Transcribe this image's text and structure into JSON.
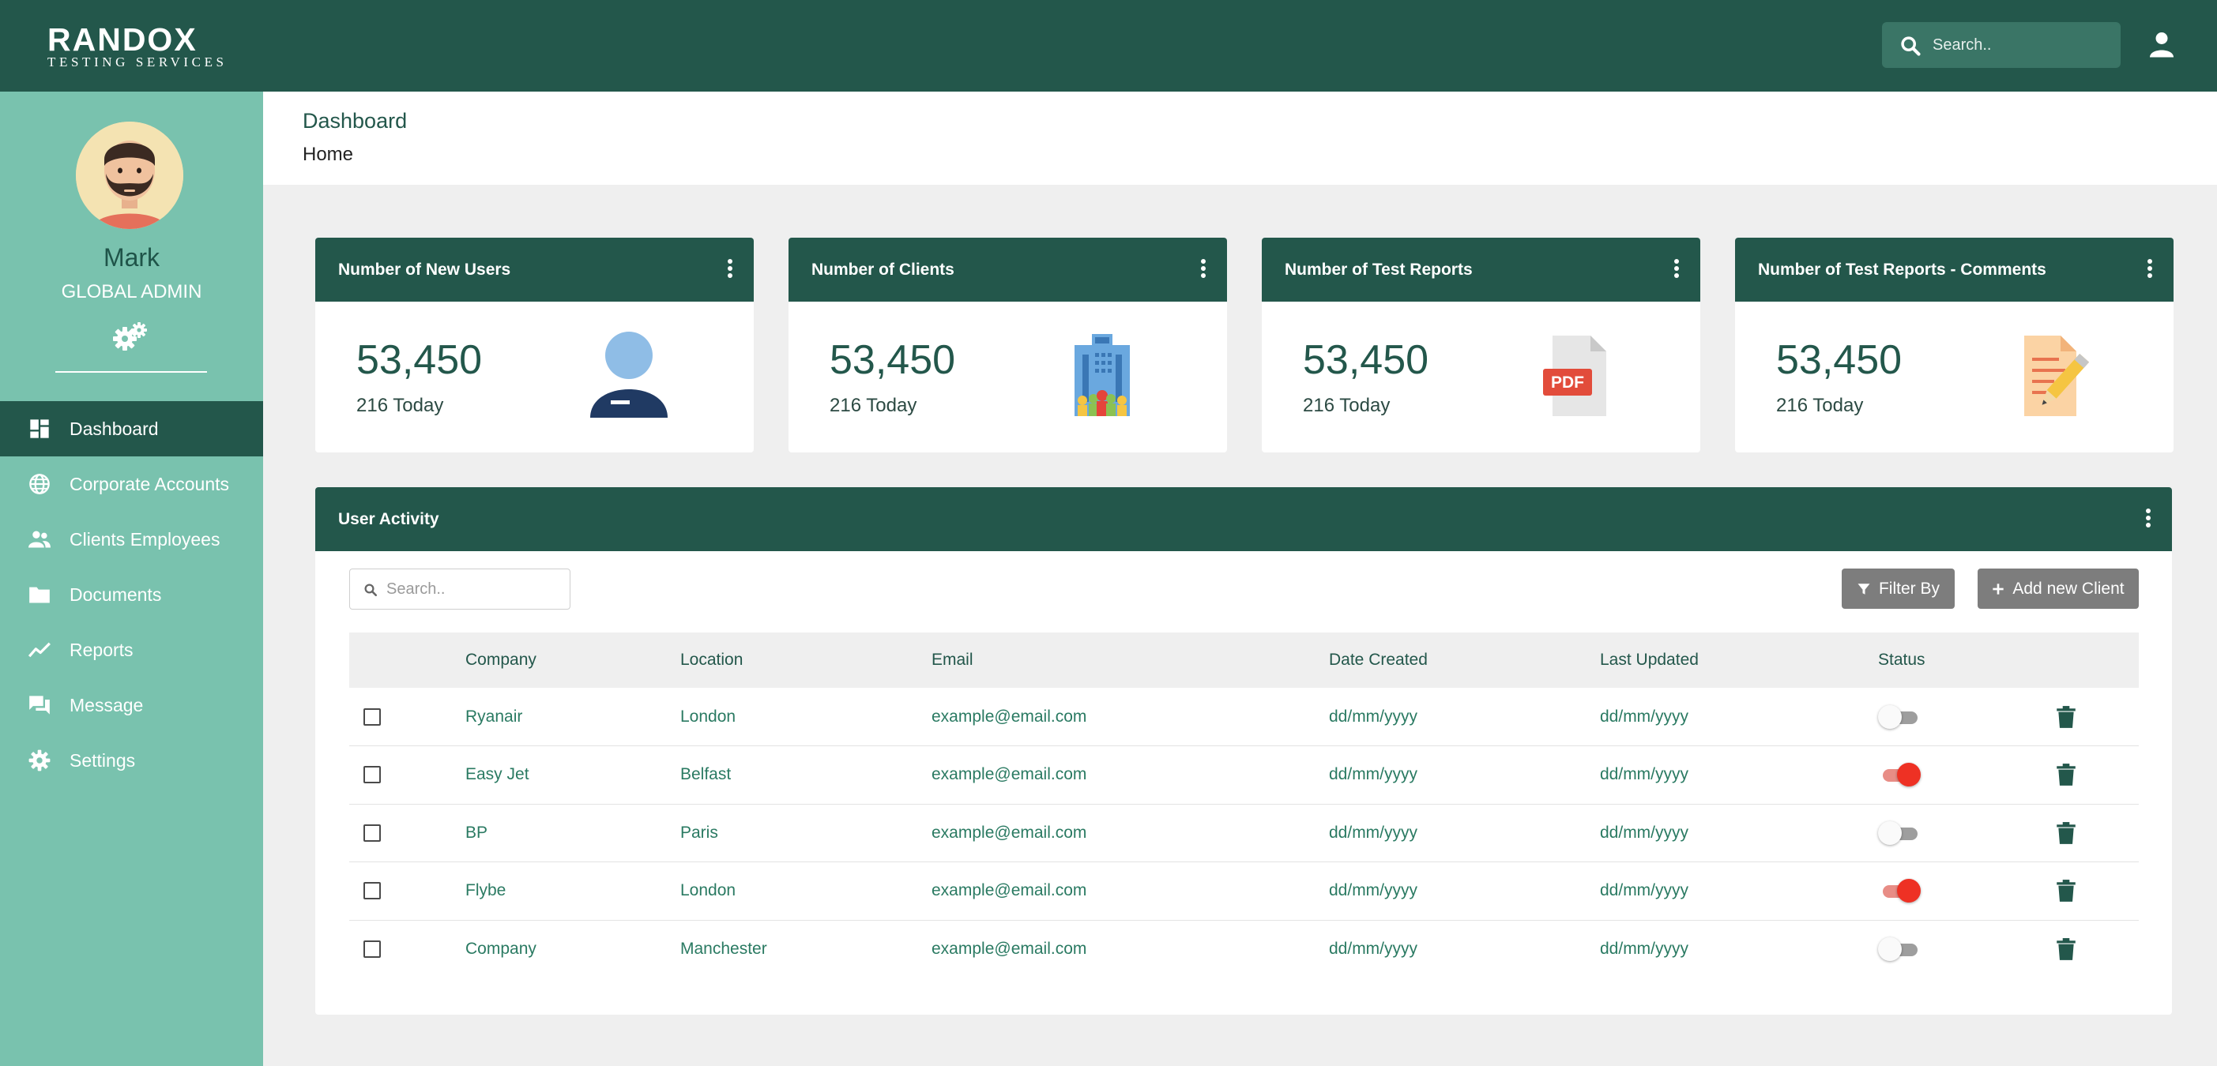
{
  "brand": {
    "name": "RANDOX",
    "tagline": "TESTING SERVICES"
  },
  "topbar": {
    "search_placeholder": "Search.."
  },
  "sidebar": {
    "user_name": "Mark",
    "user_role": "GLOBAL ADMIN",
    "items": [
      {
        "label": "Dashboard",
        "icon": "dashboard-icon",
        "active": true
      },
      {
        "label": "Corporate Accounts",
        "icon": "globe-icon"
      },
      {
        "label": "Clients Employees",
        "icon": "people-icon"
      },
      {
        "label": "Documents",
        "icon": "folder-icon"
      },
      {
        "label": "Reports",
        "icon": "trend-icon"
      },
      {
        "label": "Message",
        "icon": "chat-icon"
      },
      {
        "label": "Settings",
        "icon": "gear-icon"
      }
    ]
  },
  "header": {
    "title": "Dashboard",
    "breadcrumb": "Home"
  },
  "cards": [
    {
      "title": "Number of New Users",
      "value": "53,450",
      "sub": "216 Today",
      "icon": "user-icon"
    },
    {
      "title": "Number of Clients",
      "value": "53,450",
      "sub": "216 Today",
      "icon": "building-icon"
    },
    {
      "title": "Number of Test Reports",
      "value": "53,450",
      "sub": "216 Today",
      "icon": "pdf-icon"
    },
    {
      "title": "Number of Test Reports - Comments",
      "value": "53,450",
      "sub": "216 Today",
      "icon": "notepad-pencil-icon"
    }
  ],
  "activity": {
    "title": "User Activity",
    "search_placeholder": "Search..",
    "filter_label": "Filter By",
    "add_label": "Add new Client",
    "columns": [
      "Company",
      "Location",
      "Email",
      "Date Created",
      "Last Updated",
      "Status"
    ],
    "rows": [
      {
        "company": "Ryanair",
        "location": "London",
        "email": "example@email.com",
        "created": "dd/mm/yyyy",
        "updated": "dd/mm/yyyy",
        "status": false
      },
      {
        "company": "Easy Jet",
        "location": "Belfast",
        "email": "example@email.com",
        "created": "dd/mm/yyyy",
        "updated": "dd/mm/yyyy",
        "status": true
      },
      {
        "company": "BP",
        "location": "Paris",
        "email": "example@email.com",
        "created": "dd/mm/yyyy",
        "updated": "dd/mm/yyyy",
        "status": false
      },
      {
        "company": "Flybe",
        "location": "London",
        "email": "example@email.com",
        "created": "dd/mm/yyyy",
        "updated": "dd/mm/yyyy",
        "status": true
      },
      {
        "company": "Company",
        "location": "Manchester",
        "email": "example@email.com",
        "created": "dd/mm/yyyy",
        "updated": "dd/mm/yyyy",
        "status": false
      }
    ]
  },
  "colors": {
    "primary": "#23574b",
    "sidebar": "#79c2ae",
    "toggle_on": "#ee3124",
    "button": "#7d7d7d"
  }
}
